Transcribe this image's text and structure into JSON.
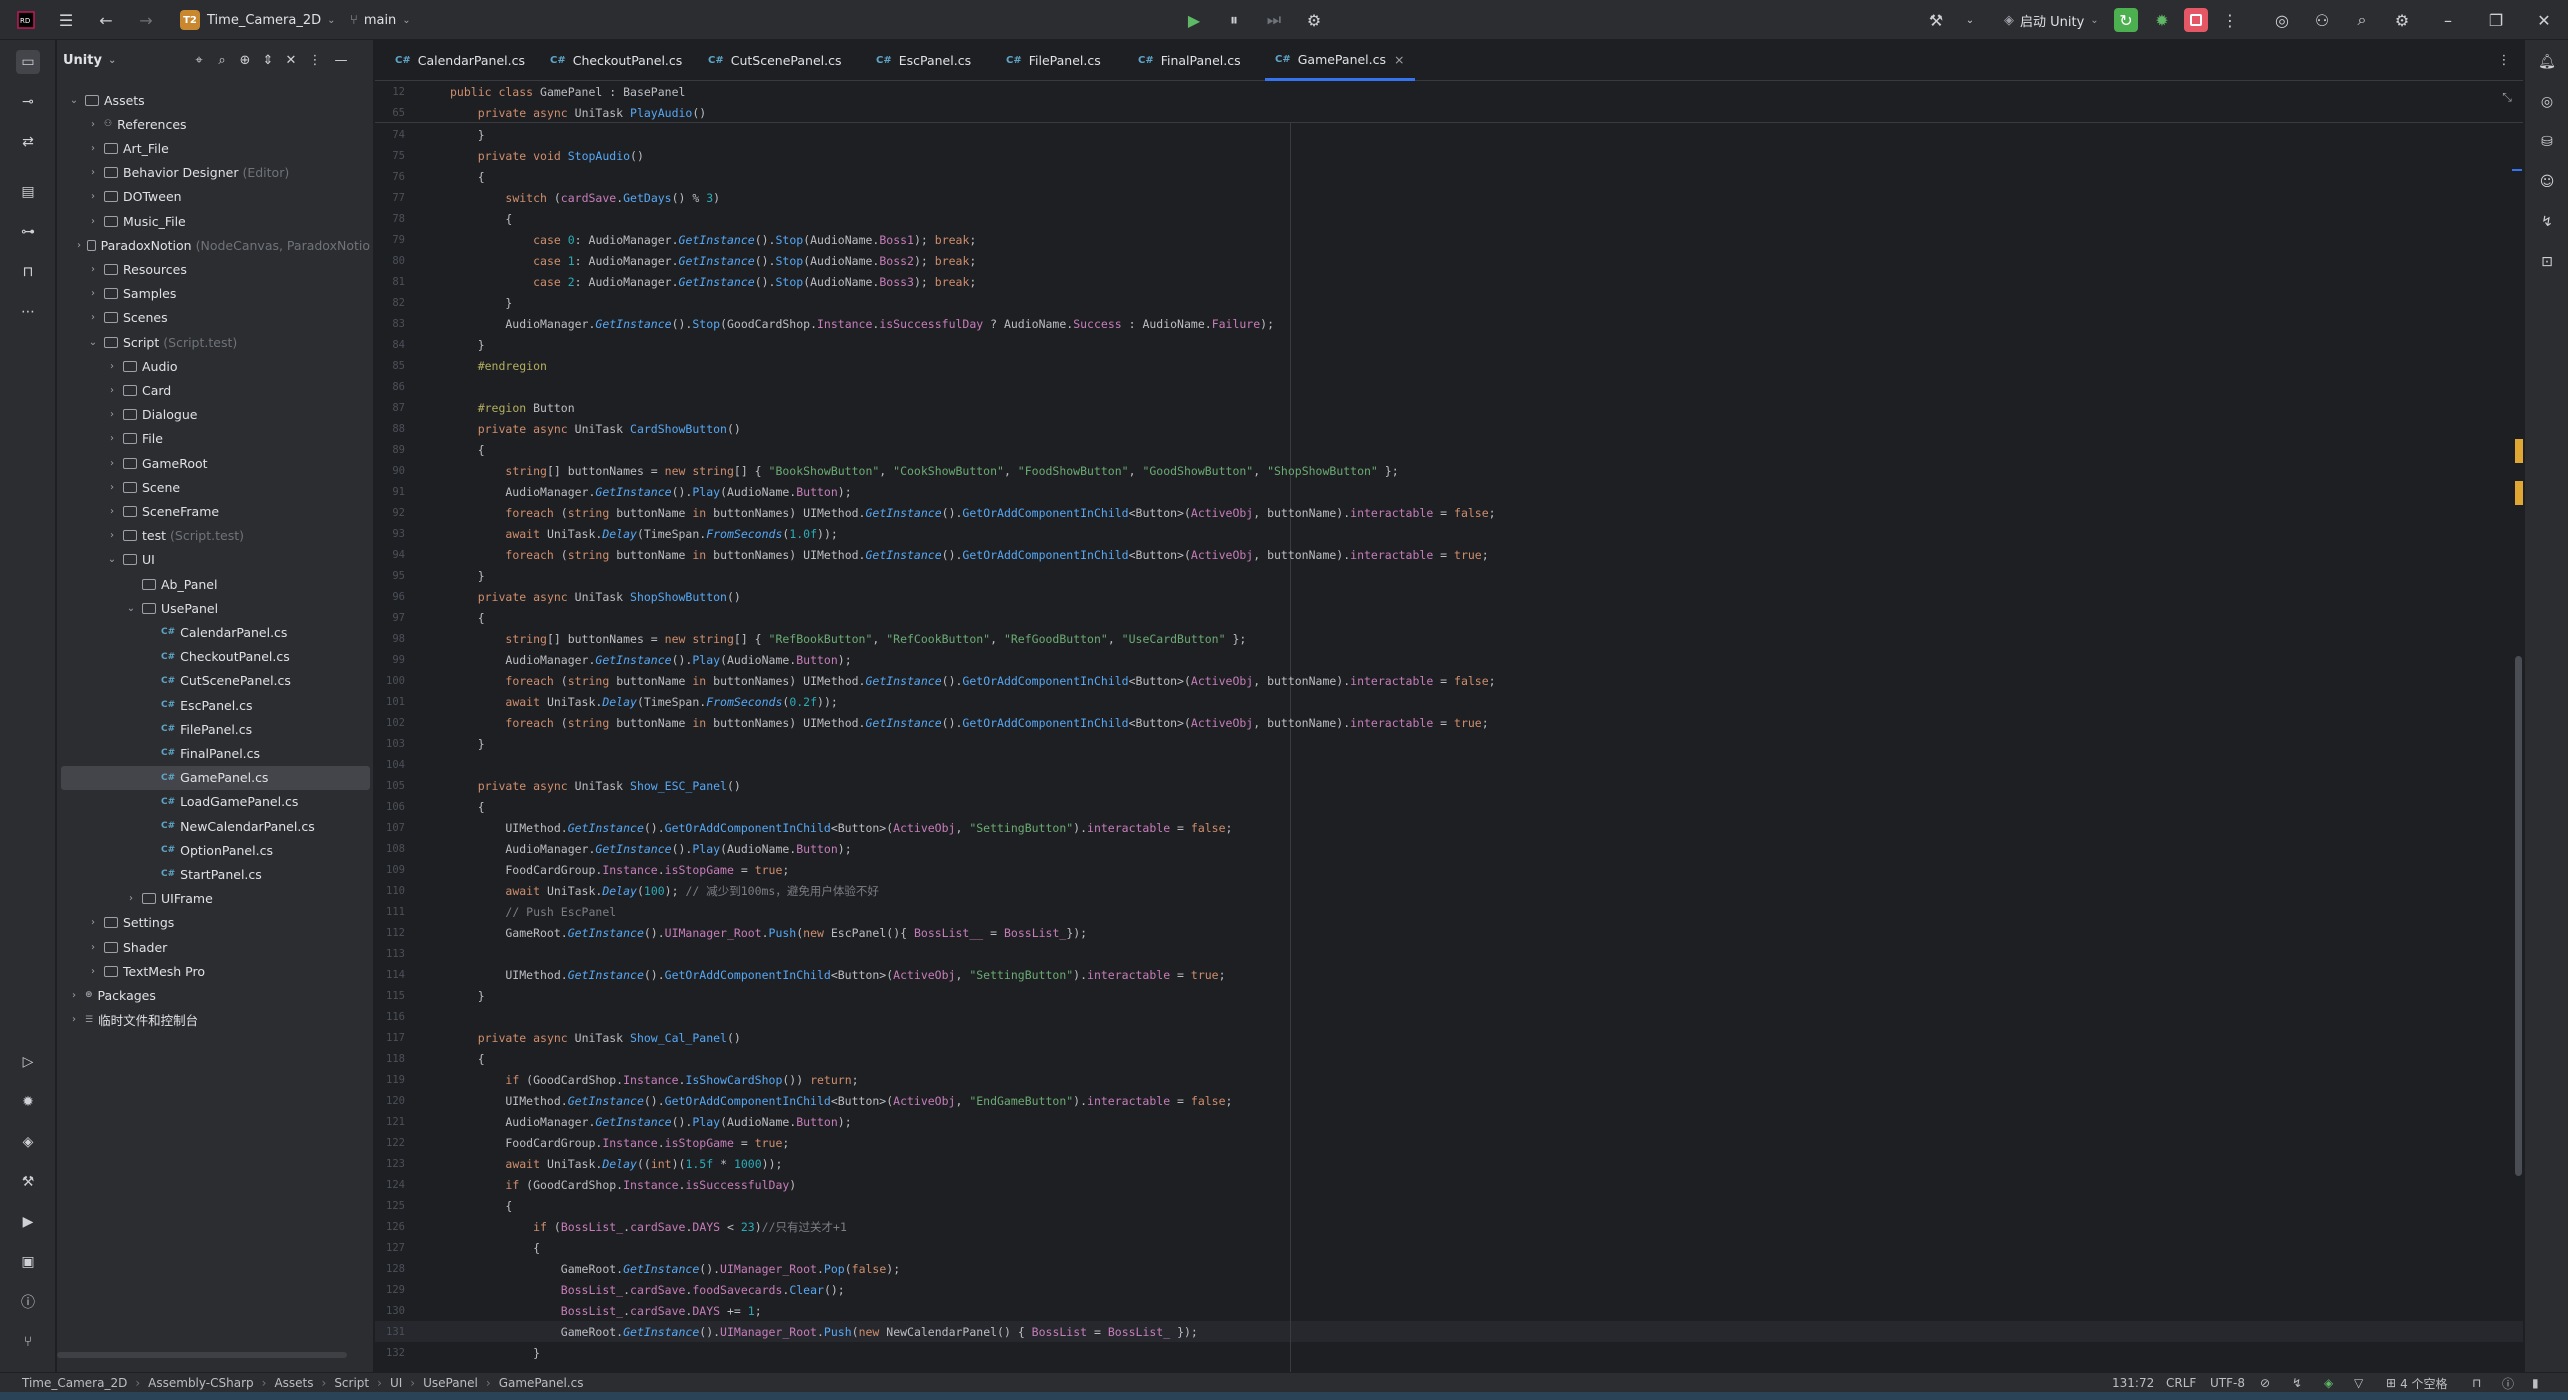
{
  "titlebar": {
    "project_badge": "T2",
    "project_name": "Time_Camera_2D",
    "branch": "main",
    "run_config": "启动 Unity"
  },
  "project_panel": {
    "title": "Unity",
    "tree": [
      {
        "label": "Assets",
        "hint": "",
        "level": 0,
        "kind": "folder",
        "expanded": true
      },
      {
        "label": "References",
        "hint": "",
        "level": 1,
        "kind": "ref",
        "expanded": false
      },
      {
        "label": "Art_File",
        "hint": "",
        "level": 1,
        "kind": "folder",
        "expanded": false
      },
      {
        "label": "Behavior Designer",
        "hint": "(Editor)",
        "level": 1,
        "kind": "folder",
        "expanded": false
      },
      {
        "label": "DOTween",
        "hint": "",
        "level": 1,
        "kind": "folder",
        "expanded": false
      },
      {
        "label": "Music_File",
        "hint": "",
        "level": 1,
        "kind": "folder",
        "expanded": false
      },
      {
        "label": "ParadoxNotion",
        "hint": "(NodeCanvas, ParadoxNotio",
        "level": 1,
        "kind": "folder",
        "expanded": false
      },
      {
        "label": "Resources",
        "hint": "",
        "level": 1,
        "kind": "folder",
        "expanded": false
      },
      {
        "label": "Samples",
        "hint": "",
        "level": 1,
        "kind": "folder",
        "expanded": false
      },
      {
        "label": "Scenes",
        "hint": "",
        "level": 1,
        "kind": "folder",
        "expanded": false
      },
      {
        "label": "Script",
        "hint": "(Script.test)",
        "level": 1,
        "kind": "folder",
        "expanded": true
      },
      {
        "label": "Audio",
        "hint": "",
        "level": 2,
        "kind": "folder",
        "expanded": false
      },
      {
        "label": "Card",
        "hint": "",
        "level": 2,
        "kind": "folder",
        "expanded": false
      },
      {
        "label": "Dialogue",
        "hint": "",
        "level": 2,
        "kind": "folder",
        "expanded": false
      },
      {
        "label": "File",
        "hint": "",
        "level": 2,
        "kind": "folder",
        "expanded": false
      },
      {
        "label": "GameRoot",
        "hint": "",
        "level": 2,
        "kind": "folder",
        "expanded": false
      },
      {
        "label": "Scene",
        "hint": "",
        "level": 2,
        "kind": "folder",
        "expanded": false
      },
      {
        "label": "SceneFrame",
        "hint": "",
        "level": 2,
        "kind": "folder",
        "expanded": false
      },
      {
        "label": "test",
        "hint": "(Script.test)",
        "level": 2,
        "kind": "folder",
        "expanded": false
      },
      {
        "label": "UI",
        "hint": "",
        "level": 2,
        "kind": "folder",
        "expanded": true
      },
      {
        "label": "Ab_Panel",
        "hint": "",
        "level": 3,
        "kind": "folder-leaf",
        "expanded": false
      },
      {
        "label": "UsePanel",
        "hint": "",
        "level": 3,
        "kind": "folder",
        "expanded": true
      },
      {
        "label": "CalendarPanel.cs",
        "hint": "",
        "level": 4,
        "kind": "file",
        "expanded": false
      },
      {
        "label": "CheckoutPanel.cs",
        "hint": "",
        "level": 4,
        "kind": "file",
        "expanded": false
      },
      {
        "label": "CutScenePanel.cs",
        "hint": "",
        "level": 4,
        "kind": "file",
        "expanded": false
      },
      {
        "label": "EscPanel.cs",
        "hint": "",
        "level": 4,
        "kind": "file",
        "expanded": false
      },
      {
        "label": "FilePanel.cs",
        "hint": "",
        "level": 4,
        "kind": "file",
        "expanded": false
      },
      {
        "label": "FinalPanel.cs",
        "hint": "",
        "level": 4,
        "kind": "file",
        "expanded": false
      },
      {
        "label": "GamePanel.cs",
        "hint": "",
        "level": 4,
        "kind": "file",
        "expanded": false,
        "selected": true
      },
      {
        "label": "LoadGamePanel.cs",
        "hint": "",
        "level": 4,
        "kind": "file",
        "expanded": false
      },
      {
        "label": "NewCalendarPanel.cs",
        "hint": "",
        "level": 4,
        "kind": "file",
        "expanded": false
      },
      {
        "label": "OptionPanel.cs",
        "hint": "",
        "level": 4,
        "kind": "file",
        "expanded": false
      },
      {
        "label": "StartPanel.cs",
        "hint": "",
        "level": 4,
        "kind": "file",
        "expanded": false
      },
      {
        "label": "UIFrame",
        "hint": "",
        "level": 3,
        "kind": "folder",
        "expanded": false
      },
      {
        "label": "Settings",
        "hint": "",
        "level": 1,
        "kind": "folder",
        "expanded": false
      },
      {
        "label": "Shader",
        "hint": "",
        "level": 1,
        "kind": "folder",
        "expanded": false
      },
      {
        "label": "TextMesh Pro",
        "hint": "",
        "level": 1,
        "kind": "folder",
        "expanded": false
      },
      {
        "label": "Packages",
        "hint": "",
        "level": 0,
        "kind": "pkg",
        "expanded": false
      },
      {
        "label": "临时文件和控制台",
        "hint": "",
        "level": 0,
        "kind": "scratch",
        "expanded": false
      }
    ]
  },
  "tabs": [
    {
      "label": "CalendarPanel.cs",
      "active": false
    },
    {
      "label": "CheckoutPanel.cs",
      "active": false
    },
    {
      "label": "CutScenePanel.cs",
      "active": false
    },
    {
      "label": "EscPanel.cs",
      "active": false
    },
    {
      "label": "FilePanel.cs",
      "active": false
    },
    {
      "label": "FinalPanel.cs",
      "active": false
    },
    {
      "label": "GamePanel.cs",
      "active": true
    }
  ],
  "tab_close_glyph": "×",
  "sticky_lines": [
    {
      "n": "12",
      "html": "<span class=\"kw\">public class</span> GamePanel : BasePanel"
    },
    {
      "n": "65",
      "html": "    <span class=\"kw\">private async</span> UniTask <span class=\"fn\">PlayAudio</span>()"
    }
  ],
  "code_lines": [
    {
      "n": "74",
      "html": "    }"
    },
    {
      "n": "75",
      "html": "    <span class=\"kw\">private void</span> <span class=\"fn\">StopAudio</span>()"
    },
    {
      "n": "76",
      "html": "    {"
    },
    {
      "n": "77",
      "html": "        <span class=\"kw\">switch</span> (<span class=\"pr\">cardSave</span>.<span class=\"fn\">GetDays</span>() % <span class=\"nm\">3</span>)"
    },
    {
      "n": "78",
      "html": "        {"
    },
    {
      "n": "79",
      "html": "            <span class=\"kw\">case</span> <span class=\"nm\">0</span>: AudioManager.<span class=\"it\">GetInstance</span>().<span class=\"fn\">Stop</span>(AudioName.<span class=\"pr\">Boss1</span>); <span class=\"kw\">break</span>;"
    },
    {
      "n": "80",
      "html": "            <span class=\"kw\">case</span> <span class=\"nm\">1</span>: AudioManager.<span class=\"it\">GetInstance</span>().<span class=\"fn\">Stop</span>(AudioName.<span class=\"pr\">Boss2</span>); <span class=\"kw\">break</span>;"
    },
    {
      "n": "81",
      "html": "            <span class=\"kw\">case</span> <span class=\"nm\">2</span>: AudioManager.<span class=\"it\">GetInstance</span>().<span class=\"fn\">Stop</span>(AudioName.<span class=\"pr\">Boss3</span>); <span class=\"kw\">break</span>;"
    },
    {
      "n": "82",
      "html": "        }"
    },
    {
      "n": "83",
      "html": "        AudioManager.<span class=\"it\">GetInstance</span>().<span class=\"fn\">Stop</span>(GoodCardShop.<span class=\"pr\">Instance</span>.<span class=\"pr\">isSuccessfulDay</span> ? AudioName.<span class=\"pr\">Success</span> : AudioName.<span class=\"pr\">Failure</span>);"
    },
    {
      "n": "84",
      "html": "    }"
    },
    {
      "n": "85",
      "html": "    <span class=\"pp\">#endregion</span>"
    },
    {
      "n": "86",
      "html": ""
    },
    {
      "n": "87",
      "html": "    <span class=\"pp\">#region</span> Button"
    },
    {
      "n": "88",
      "html": "    <span class=\"kw\">private async</span> UniTask <span class=\"fn\">CardShowButton</span>()"
    },
    {
      "n": "89",
      "html": "    {"
    },
    {
      "n": "90",
      "html": "        <span class=\"kw\">string</span>[] buttonNames = <span class=\"kw\">new string</span>[] { <span class=\"st\">\"BookShowButton\"</span>, <span class=\"st\">\"CookShowButton\"</span>, <span class=\"st\">\"FoodShowButton\"</span>, <span class=\"st\">\"GoodShowButton\"</span>, <span class=\"st\">\"ShopShowButton\"</span> };"
    },
    {
      "n": "91",
      "html": "        AudioManager.<span class=\"it\">GetInstance</span>().<span class=\"fn\">Play</span>(AudioName.<span class=\"pr\">Button</span>);"
    },
    {
      "n": "92",
      "html": "        <span class=\"kw\">foreach</span> (<span class=\"kw\">string</span> buttonName <span class=\"kw\">in</span> buttonNames) UIMethod.<span class=\"it\">GetInstance</span>().<span class=\"fn\">GetOrAddComponentInChild</span>&lt;Button&gt;(<span class=\"pr\">ActiveObj</span>, buttonName).<span class=\"pr\">interactable</span> = <span class=\"kw\">false</span>;"
    },
    {
      "n": "93",
      "html": "        <span class=\"kw\">await</span> UniTask.<span class=\"it\">Delay</span>(TimeSpan.<span class=\"it\">FromSeconds</span>(<span class=\"nm\">1.0f</span>));"
    },
    {
      "n": "94",
      "html": "        <span class=\"kw\">foreach</span> (<span class=\"kw\">string</span> buttonName <span class=\"kw\">in</span> buttonNames) UIMethod.<span class=\"it\">GetInstance</span>().<span class=\"fn\">GetOrAddComponentInChild</span>&lt;Button&gt;(<span class=\"pr\">ActiveObj</span>, buttonName).<span class=\"pr\">interactable</span> = <span class=\"kw\">true</span>;"
    },
    {
      "n": "95",
      "html": "    }"
    },
    {
      "n": "96",
      "html": "    <span class=\"kw\">private async</span> UniTask <span class=\"fn\">ShopShowButton</span>()"
    },
    {
      "n": "97",
      "html": "    {"
    },
    {
      "n": "98",
      "html": "        <span class=\"kw\">string</span>[] buttonNames = <span class=\"kw\">new string</span>[] { <span class=\"st\">\"RefBookButton\"</span>, <span class=\"st\">\"RefCookButton\"</span>, <span class=\"st\">\"RefGoodButton\"</span>, <span class=\"st\">\"UseCardButton\"</span> };"
    },
    {
      "n": "99",
      "html": "        AudioManager.<span class=\"it\">GetInstance</span>().<span class=\"fn\">Play</span>(AudioName.<span class=\"pr\">Button</span>);"
    },
    {
      "n": "100",
      "html": "        <span class=\"kw\">foreach</span> (<span class=\"kw\">string</span> buttonName <span class=\"kw\">in</span> buttonNames) UIMethod.<span class=\"it\">GetInstance</span>().<span class=\"fn\">GetOrAddComponentInChild</span>&lt;Button&gt;(<span class=\"pr\">ActiveObj</span>, buttonName).<span class=\"pr\">interactable</span> = <span class=\"kw\">false</span>;"
    },
    {
      "n": "101",
      "html": "        <span class=\"kw\">await</span> UniTask.<span class=\"it\">Delay</span>(TimeSpan.<span class=\"it\">FromSeconds</span>(<span class=\"nm\">0.2f</span>));"
    },
    {
      "n": "102",
      "html": "        <span class=\"kw\">foreach</span> (<span class=\"kw\">string</span> buttonName <span class=\"kw\">in</span> buttonNames) UIMethod.<span class=\"it\">GetInstance</span>().<span class=\"fn\">GetOrAddComponentInChild</span>&lt;Button&gt;(<span class=\"pr\">ActiveObj</span>, buttonName).<span class=\"pr\">interactable</span> = <span class=\"kw\">true</span>;"
    },
    {
      "n": "103",
      "html": "    }"
    },
    {
      "n": "104",
      "html": ""
    },
    {
      "n": "105",
      "html": "    <span class=\"kw\">private async</span> UniTask <span class=\"fn\">Show_ESC_Panel</span>()"
    },
    {
      "n": "106",
      "html": "    {"
    },
    {
      "n": "107",
      "html": "        UIMethod.<span class=\"it\">GetInstance</span>().<span class=\"fn\">GetOrAddComponentInChild</span>&lt;Button&gt;(<span class=\"pr\">ActiveObj</span>, <span class=\"st\">\"SettingButton\"</span>).<span class=\"pr\">interactable</span> = <span class=\"kw\">false</span>;"
    },
    {
      "n": "108",
      "html": "        AudioManager.<span class=\"it\">GetInstance</span>().<span class=\"fn\">Play</span>(AudioName.<span class=\"pr\">Button</span>);"
    },
    {
      "n": "109",
      "html": "        FoodCardGroup.<span class=\"pr\">Instance</span>.<span class=\"pr\">isStopGame</span> = <span class=\"kw\">true</span>;"
    },
    {
      "n": "110",
      "html": "        <span class=\"kw\">await</span> UniTask.<span class=\"it\">Delay</span>(<span class=\"nm\">100</span>); <span class=\"cm\">// 减少到100ms，避免用户体验不好</span>"
    },
    {
      "n": "111",
      "html": "        <span class=\"cm\">// Push EscPanel</span>"
    },
    {
      "n": "112",
      "html": "        GameRoot.<span class=\"it\">GetInstance</span>().<span class=\"pr\">UIManager_Root</span>.<span class=\"fn\">Push</span>(<span class=\"kw\">new</span> EscPanel(){ <span class=\"pr\">BossList__</span> = <span class=\"pr\">BossList_</span>});"
    },
    {
      "n": "113",
      "html": ""
    },
    {
      "n": "114",
      "html": "        UIMethod.<span class=\"it\">GetInstance</span>().<span class=\"fn\">GetOrAddComponentInChild</span>&lt;Button&gt;(<span class=\"pr\">ActiveObj</span>, <span class=\"st\">\"SettingButton\"</span>).<span class=\"pr\">interactable</span> = <span class=\"kw\">true</span>;"
    },
    {
      "n": "115",
      "html": "    }"
    },
    {
      "n": "116",
      "html": ""
    },
    {
      "n": "117",
      "html": "    <span class=\"kw\">private async</span> UniTask <span class=\"fn\">Show_Cal_Panel</span>()"
    },
    {
      "n": "118",
      "html": "    {"
    },
    {
      "n": "119",
      "html": "        <span class=\"kw\">if</span> (GoodCardShop.<span class=\"pr\">Instance</span>.<span class=\"fn\">IsShowCardShop</span>()) <span class=\"kw\">return</span>;"
    },
    {
      "n": "120",
      "html": "        UIMethod.<span class=\"it\">GetInstance</span>().<span class=\"fn\">GetOrAddComponentInChild</span>&lt;Button&gt;(<span class=\"pr\">ActiveObj</span>, <span class=\"st\">\"EndGameButton\"</span>).<span class=\"pr\">interactable</span> = <span class=\"kw\">false</span>;"
    },
    {
      "n": "121",
      "html": "        AudioManager.<span class=\"it\">GetInstance</span>().<span class=\"fn\">Play</span>(AudioName.<span class=\"pr\">Button</span>);"
    },
    {
      "n": "122",
      "html": "        FoodCardGroup.<span class=\"pr\">Instance</span>.<span class=\"pr\">isStopGame</span> = <span class=\"kw\">true</span>;"
    },
    {
      "n": "123",
      "html": "        <span class=\"kw\">await</span> UniTask.<span class=\"it\">Delay</span>((<span class=\"kw\">int</span>)(<span class=\"nm\">1.5f</span> * <span class=\"nm\">1000</span>));"
    },
    {
      "n": "124",
      "html": "        <span class=\"kw\">if</span> (GoodCardShop.<span class=\"pr\">Instance</span>.<span class=\"pr\">isSuccessfulDay</span>)"
    },
    {
      "n": "125",
      "html": "        {"
    },
    {
      "n": "126",
      "html": "            <span class=\"kw\">if</span> (<span class=\"pr\">BossList_</span>.<span class=\"pr\">cardSave</span>.<span class=\"pr\">DAYS</span> &lt; <span class=\"nm\">23</span>)<span class=\"cm\">//只有过关才+1</span>"
    },
    {
      "n": "127",
      "html": "            {"
    },
    {
      "n": "128",
      "html": "                GameRoot.<span class=\"it\">GetInstance</span>().<span class=\"pr\">UIManager_Root</span>.<span class=\"fn\">Pop</span>(<span class=\"kw\">false</span>);"
    },
    {
      "n": "129",
      "html": "                <span class=\"pr\">BossList_</span>.<span class=\"pr\">cardSave</span>.<span class=\"pr\">foodSavecards</span>.<span class=\"fn\">Clear</span>();"
    },
    {
      "n": "130",
      "html": "                <span class=\"pr\">BossList_</span>.<span class=\"pr\">cardSave</span>.<span class=\"pr\">DAYS</span> += <span class=\"nm\">1</span>;"
    },
    {
      "n": "131",
      "html": "                GameRoot.<span class=\"it\">GetInstance</span>().<span class=\"pr\">UIManager_Root</span>.<span class=\"fn\">Push</span>(<span class=\"kw\">new</span> NewCalendarPanel() { <span class=\"pr\">BossList</span> = <span class=\"pr\">BossList_</span> });"
    },
    {
      "n": "132",
      "html": "            }"
    }
  ],
  "breadcrumb": [
    "Time_Camera_2D",
    "Assembly-CSharp",
    "Assets",
    "Script",
    "UI",
    "UsePanel",
    "GamePanel.cs"
  ],
  "breadcrumb_sep": "›",
  "status": {
    "position": "131:72",
    "line_ending": "CRLF",
    "encoding": "UTF-8",
    "indent": "4 个空格"
  },
  "colors": {
    "accent": "#3574f0",
    "run_green": "#4caf50",
    "stop_red": "#e55765",
    "marker_yellow": "#e0a832"
  }
}
